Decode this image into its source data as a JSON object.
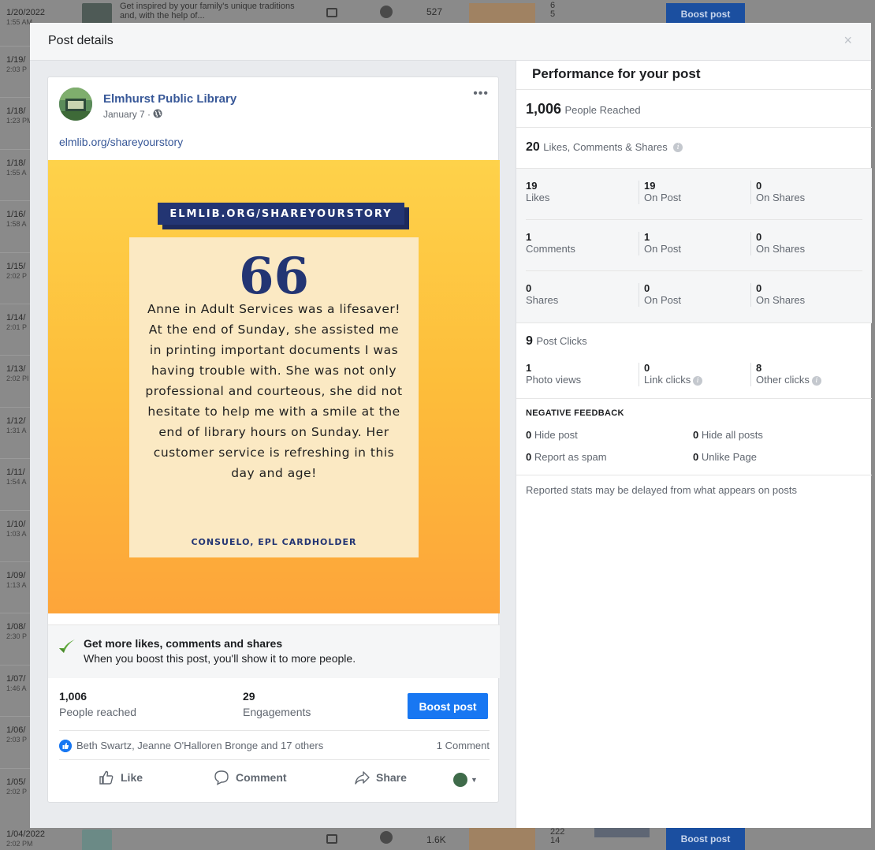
{
  "background_table": {
    "top_row": {
      "date": "1/20/2022",
      "time": "1:55 AM",
      "description": "Get inspired by your family's unique traditions and, with the help of...",
      "reach": "527",
      "nums": [
        "6",
        "5"
      ],
      "boost_label": "Boost post"
    },
    "side_rows": [
      {
        "date": "1/19/",
        "time": "2:03 P"
      },
      {
        "date": "1/18/",
        "time": "1:23 PM"
      },
      {
        "date": "1/18/",
        "time": "1:55 A"
      },
      {
        "date": "1/16/",
        "time": "1:58 A"
      },
      {
        "date": "1/15/",
        "time": "2:02 P"
      },
      {
        "date": "1/14/",
        "time": "2:01 P"
      },
      {
        "date": "1/13/",
        "time": "2:02 PI"
      },
      {
        "date": "1/12/",
        "time": "1:31 A"
      },
      {
        "date": "1/11/",
        "time": "1:54 A"
      },
      {
        "date": "1/10/",
        "time": "1:03 A"
      },
      {
        "date": "1/09/",
        "time": "1:13 A"
      },
      {
        "date": "1/08/",
        "time": "2:30 P"
      },
      {
        "date": "1/07/",
        "time": "1:46 A"
      },
      {
        "date": "1/06/",
        "time": "2:03 P"
      },
      {
        "date": "1/05/",
        "time": "2:02 P"
      }
    ],
    "bottom_row": {
      "date": "1/04/2022",
      "time": "2:02 PM",
      "reach": "1.6K",
      "nums": [
        "222",
        "14"
      ],
      "boost_label": "Boost post"
    }
  },
  "modal": {
    "title": "Post details",
    "close_label": "×"
  },
  "post": {
    "page_name": "Elmhurst Public Library",
    "date": "January 7 · ",
    "text": "elmlib.org/shareyourstory",
    "more_label": "•••",
    "image": {
      "banner": "ELMLIB.ORG/SHAREYOURSTORY",
      "quote_mark": "66",
      "quote": "Anne in Adult Services was a lifesaver! At the end of Sunday, she assisted me in printing important documents I was having trouble with. She was not only professional and courteous, she did not hesitate to help me with a smile at the end of library hours on Sunday. Her customer service is refreshing in this day and age!",
      "attribution": "CONSUELO, EPL CARDHOLDER"
    },
    "promo": {
      "title": "Get more likes, comments and shares",
      "subtitle": "When you boost this post, you'll show it to more people."
    },
    "people_reached": {
      "value": "1,006",
      "label": "People reached"
    },
    "engagements": {
      "value": "29",
      "label": "Engagements"
    },
    "boost_button": "Boost post",
    "reactors": "Beth Swartz, Jeanne O'Halloren Bronge and 17 others",
    "comment_count": "1 Comment",
    "actions": {
      "like": "Like",
      "comment": "Comment",
      "share": "Share"
    }
  },
  "performance": {
    "title": "Performance for your post",
    "reached": {
      "value": "1,006",
      "label": "People Reached"
    },
    "engagement_total": {
      "value": "20",
      "label": "Likes, Comments & Shares"
    },
    "grid": [
      {
        "total": "19",
        "total_label": "Likes",
        "on_post": "19",
        "on_post_label": "On Post",
        "on_shares": "0",
        "on_shares_label": "On Shares"
      },
      {
        "total": "1",
        "total_label": "Comments",
        "on_post": "1",
        "on_post_label": "On Post",
        "on_shares": "0",
        "on_shares_label": "On Shares"
      },
      {
        "total": "0",
        "total_label": "Shares",
        "on_post": "0",
        "on_post_label": "On Post",
        "on_shares": "0",
        "on_shares_label": "On Shares"
      }
    ],
    "post_clicks": {
      "value": "9",
      "label": "Post Clicks"
    },
    "clicks": [
      {
        "value": "1",
        "label": "Photo views"
      },
      {
        "value": "0",
        "label": "Link clicks"
      },
      {
        "value": "8",
        "label": "Other clicks"
      }
    ],
    "negative_title": "NEGATIVE FEEDBACK",
    "negative": [
      {
        "value": "0",
        "label": "Hide post"
      },
      {
        "value": "0",
        "label": "Hide all posts"
      },
      {
        "value": "0",
        "label": "Report as spam"
      },
      {
        "value": "0",
        "label": "Unlike Page"
      }
    ],
    "disclaimer": "Reported stats may be delayed from what appears on posts"
  },
  "colors": {
    "accent": "#1877f2",
    "link": "#385898",
    "banner_navy": "#233573",
    "image_yellow": "#fed24a",
    "image_orange": "#fda53a"
  },
  "icons": [
    "globe-icon",
    "check-icon",
    "info-icon",
    "like-icon",
    "comment-icon",
    "share-icon",
    "caret-down-icon",
    "close-icon",
    "more-icon"
  ]
}
